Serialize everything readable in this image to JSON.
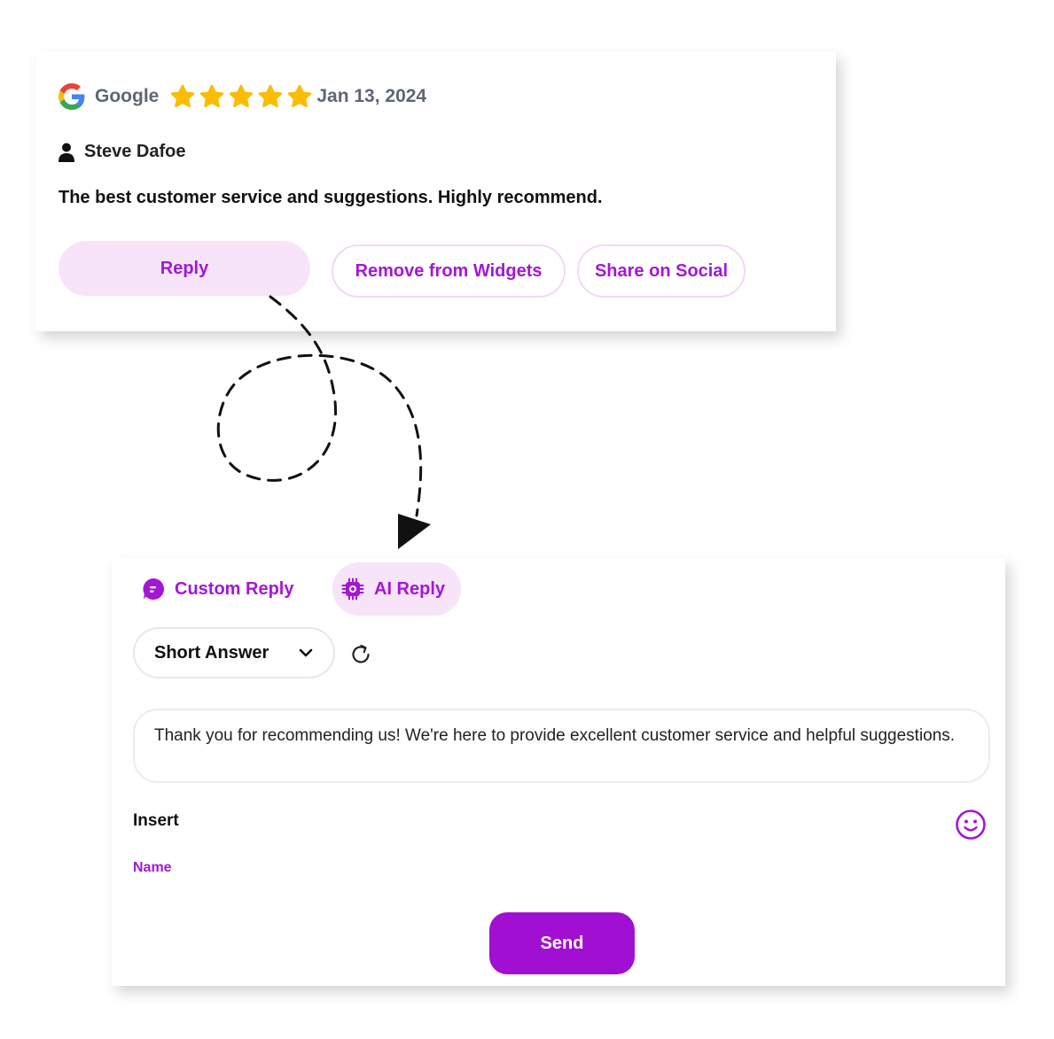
{
  "colors": {
    "accent": "#a317d4",
    "accent_soft": "#f7e4f9",
    "send_bg": "#a10fd3",
    "star": "#fbbc05",
    "meta_text": "#5f6672"
  },
  "review": {
    "source": "Google",
    "source_icon": "google-g-logo",
    "rating": 5,
    "date": "Jan 13, 2024",
    "author": "Steve Dafoe",
    "author_icon": "person-icon",
    "text": "The best customer service and suggestions. Highly recommend.",
    "actions": {
      "reply": "Reply",
      "remove": "Remove from Widgets",
      "share": "Share on Social"
    }
  },
  "reply_panel": {
    "tabs": [
      {
        "label": "Custom Reply",
        "icon": "chat-bubble-icon"
      },
      {
        "label": "AI Reply",
        "icon": "chip-icon",
        "active": true
      }
    ],
    "length_select": {
      "value": "Short Answer",
      "icon": "chevron-down-icon"
    },
    "refresh_icon": "refresh-icon",
    "reply_text": "Thank you for recommending us! We're here to provide excellent customer service and helpful suggestions.",
    "insert_label": "Insert",
    "insert_tokens": [
      "Name"
    ],
    "emoji_icon": "smiley-icon",
    "send_label": "Send"
  }
}
